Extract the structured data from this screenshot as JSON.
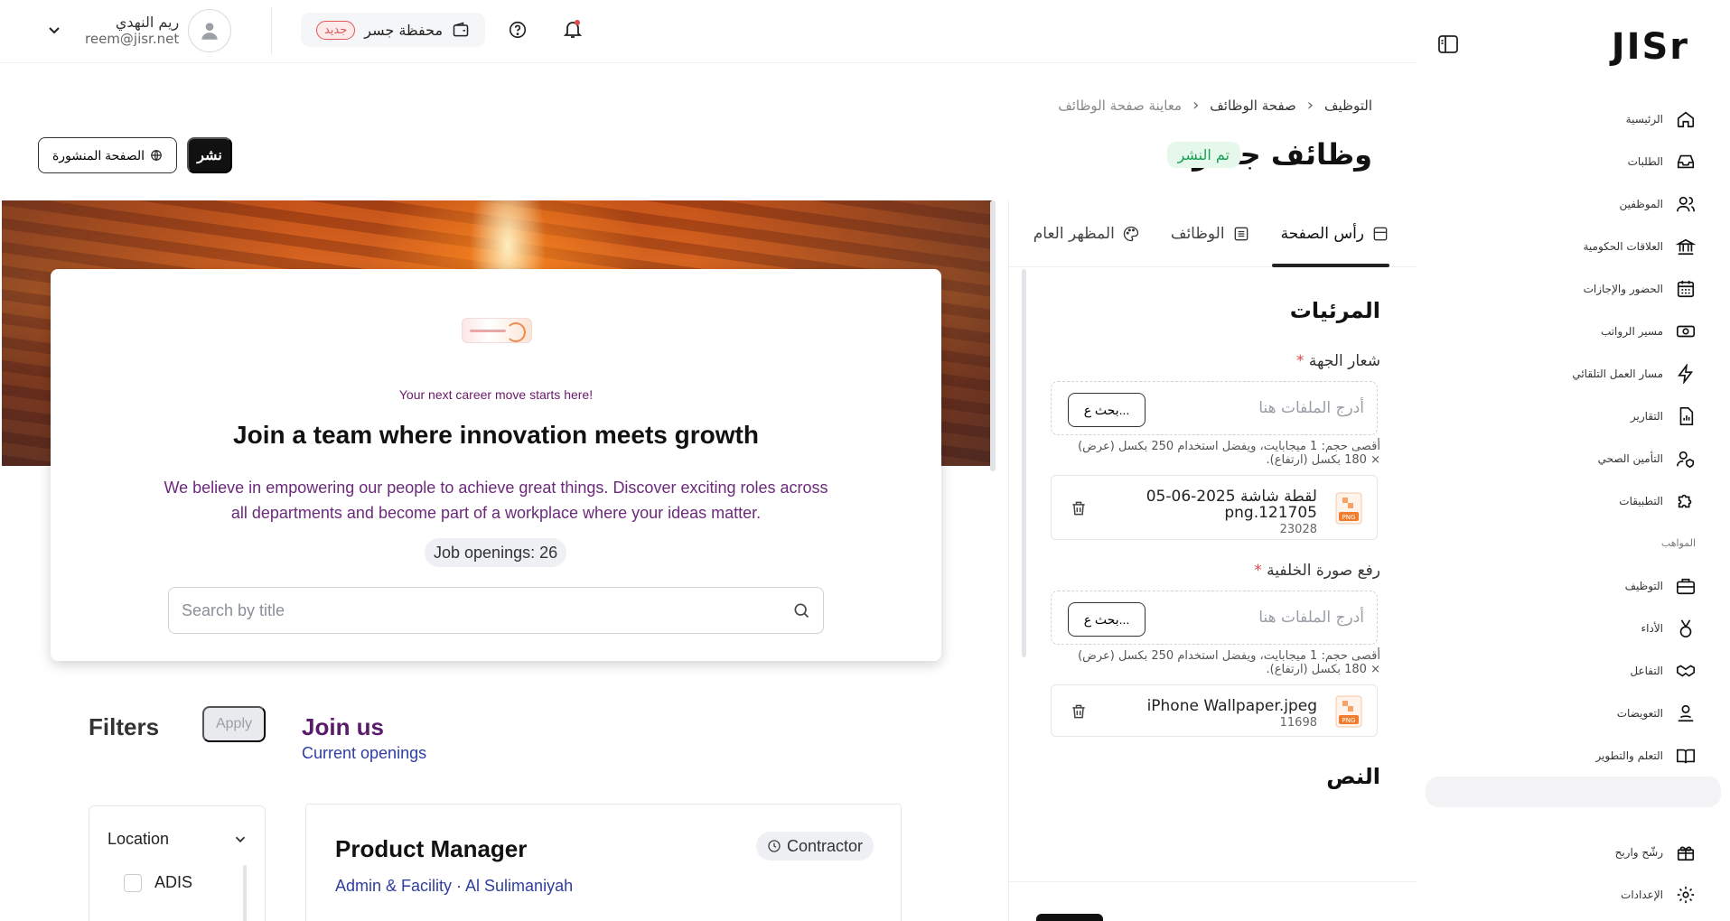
{
  "sidebar": {
    "logo": "JISr",
    "items": [
      {
        "label": "الرئيسية",
        "icon": "home-icon"
      },
      {
        "label": "الطلبات",
        "icon": "inbox-icon"
      },
      {
        "label": "الموظفين",
        "icon": "users-icon"
      },
      {
        "label": "العلاقات الحكومية",
        "icon": "government-icon"
      },
      {
        "label": "الحضور والإجازات",
        "icon": "calendar-icon"
      },
      {
        "label": "مسير الرواتب",
        "icon": "payroll-icon"
      },
      {
        "label": "مسار العمل التلقائي",
        "icon": "automation-icon"
      },
      {
        "label": "التقارير",
        "icon": "reports-icon"
      },
      {
        "label": "التأمين الصحي",
        "icon": "health-insurance-icon"
      },
      {
        "label": "التطبيقات",
        "icon": "puzzle-icon"
      }
    ],
    "section_talent": "المواهب",
    "talent_items": [
      {
        "label": "التوظيف",
        "icon": "briefcase-icon"
      },
      {
        "label": "الأداء",
        "icon": "medal-icon"
      },
      {
        "label": "التفاعل",
        "icon": "handshake-icon"
      },
      {
        "label": "التعويضات",
        "icon": "compensation-icon"
      },
      {
        "label": "التعلم والتطوير",
        "icon": "book-icon"
      }
    ],
    "bottom_items": [
      {
        "label": "رشّح واربح",
        "icon": "gift-icon"
      },
      {
        "label": "الإعدادات",
        "icon": "gear-icon"
      }
    ]
  },
  "topbar": {
    "user_name": "ريم النهدي",
    "user_email": "reem@jisr.net",
    "wallet_label": "محفظة جسر",
    "wallet_badge": "جديد"
  },
  "header": {
    "breadcrumb": [
      "التوظيف",
      "صفحة الوظائف",
      "معاينة صفحة الوظائف"
    ],
    "title": "وظائف جسر",
    "status": "تم النشر",
    "publish_button": "نشر",
    "published_page_button": "الصفحة المنشورة"
  },
  "preview": {
    "tagline": "Your next career move starts here!",
    "hero_title": "Join a team where innovation meets growth",
    "hero_description": "We believe in empowering our people to achieve great things. Discover exciting roles across all departments and become part of a workplace where your ideas matter.",
    "job_openings": "Job openings: 26",
    "search_placeholder": "Search by title",
    "filters_title": "Filters",
    "apply_button": "Apply",
    "join_title": "Join us",
    "join_subtitle": "Current openings",
    "filter_location_label": "Location",
    "filter_option_1": "ADIS",
    "job": {
      "title": "Product Manager",
      "meta": "Admin & Facility · Al Sulimaniyah",
      "type": "Contractor"
    }
  },
  "editor": {
    "tabs": [
      {
        "label": "رأس الصفحة",
        "icon": "layout-icon",
        "active": true
      },
      {
        "label": "الوظائف",
        "icon": "list-icon",
        "active": false
      },
      {
        "label": "المظهر العام",
        "icon": "palette-icon",
        "active": false
      }
    ],
    "section_title": "المرئيات",
    "logo_label": "شعار الجهة",
    "background_label": "رفع صورة الخلفية",
    "required_mark": "*",
    "dropzone_placeholder": "أدرج الملفات هنا",
    "browse_button": "بحث ع...",
    "hint": "أقصى حجم: 1 ميجابايت، ويفضل استخدام 250 بكسل (عرض) × 180 بكسل (ارتفاع).",
    "file1_name": "لقطة شاشة 2025-06-05 121705.png",
    "file1_size": "23028",
    "file2_name": "iPhone Wallpaper.jpeg",
    "file2_size": "11698",
    "file_type": "PNG",
    "next_section": "النص"
  },
  "colors": {
    "brand_purple": "#5a1c6a",
    "link_blue": "#2f3ea0",
    "success_green": "#18a052",
    "danger_red": "#e0484d"
  }
}
